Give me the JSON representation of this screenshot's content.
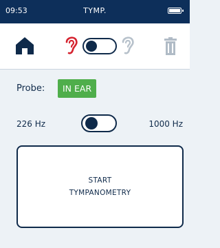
{
  "status": {
    "time": "09:53",
    "title": "TYMP.",
    "battery_level": 1.0
  },
  "toolbar": {
    "icons": {
      "home": "home-icon",
      "active_ear": "ear-red-icon",
      "inactive_ear": "ear-gray-icon",
      "delete": "trash-icon"
    },
    "ear_toggle": {
      "state": "left"
    }
  },
  "probe": {
    "label": "Probe:",
    "status": "IN EAR",
    "status_color": "#4fae4b"
  },
  "frequency": {
    "left_label": "226 Hz",
    "right_label": "1000 Hz",
    "selected": "226 Hz"
  },
  "start_button": {
    "line1": "START",
    "line2": "TYMPANOMETRY"
  },
  "colors": {
    "header": "#0d2f5a",
    "background": "#edf2f6",
    "accent_red": "#d5232f",
    "text": "#0f2a4a"
  }
}
